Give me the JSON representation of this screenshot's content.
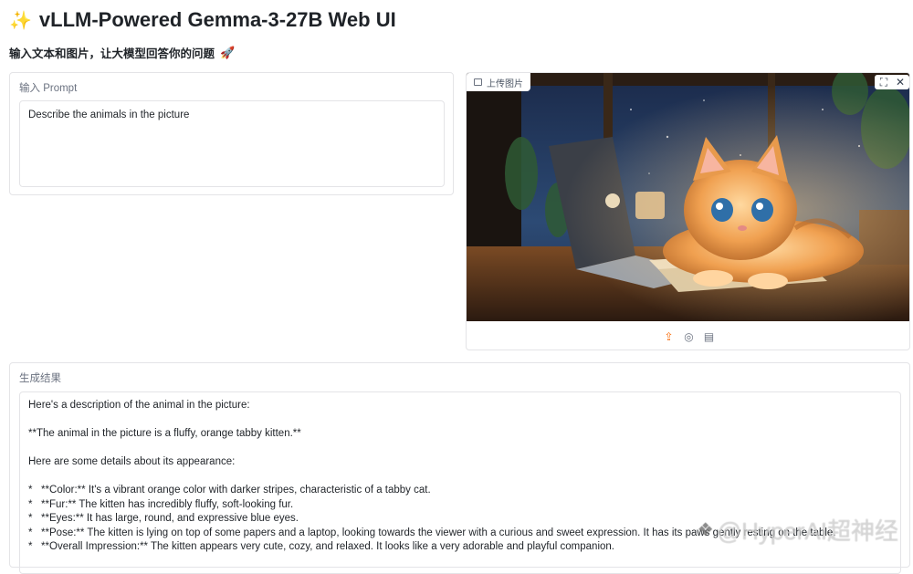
{
  "header": {
    "title": "vLLM-Powered Gemma-3-27B Web UI",
    "spark_icon": "✨",
    "subtitle": "输入文本和图片，让大模型回答你的问题",
    "rocket_icon": "🚀"
  },
  "prompt_panel": {
    "label": "输入 Prompt",
    "value": "Describe the animals in the picture"
  },
  "image_panel": {
    "label": "上传图片",
    "tools": [
      "fullscreen-icon",
      "close-icon"
    ],
    "bottom_tools": [
      "upload-icon",
      "webcam-icon",
      "clipboard-icon"
    ]
  },
  "result_panel": {
    "label": "生成结果",
    "lines": [
      "Here's a description of the animal in the picture:",
      "",
      "**The animal in the picture is a fluffy, orange tabby kitten.**",
      "",
      "Here are some details about its appearance:",
      "",
      "*   **Color:** It's a vibrant orange color with darker stripes, characteristic of a tabby cat.",
      "*   **Fur:** The kitten has incredibly fluffy, soft-looking fur.",
      "*   **Eyes:** It has large, round, and expressive blue eyes.",
      "*   **Pose:** The kitten is lying on top of some papers and a laptop, looking towards the viewer with a curious and sweet expression. It has its paws gently resting on the table.",
      "*   **Overall Impression:** The kitten appears very cute, cozy, and relaxed. It looks like a very adorable and playful companion."
    ]
  },
  "watermark": {
    "text": "@HyperAI超神经"
  },
  "colors": {
    "accent": "#f97316",
    "border": "#e4e4e7",
    "label": "#6b7280"
  }
}
